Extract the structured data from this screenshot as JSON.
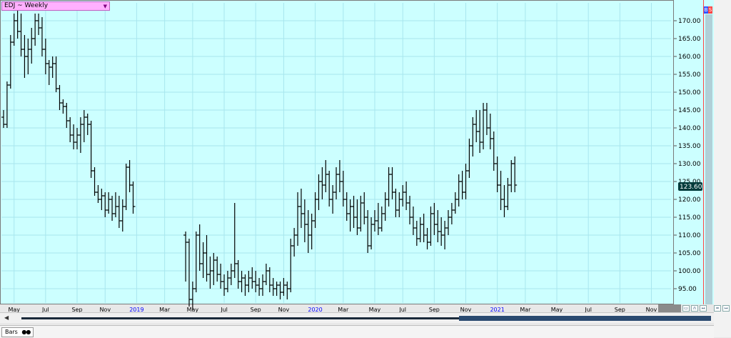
{
  "window": {
    "title": "EDJ ~ Weekly"
  },
  "footer": {
    "tab_label": "Bars"
  },
  "badge": {
    "b": "B",
    "s": "S"
  },
  "scroll": {
    "left_arrow": "◀"
  },
  "colors": {
    "plot_bg": "#ccffff",
    "bars": "#000000",
    "grid": "#a8e6ee",
    "price_tag_bg": "#003a3a",
    "price_tag_fg": "#ffffff",
    "year_label": "#0000ff"
  },
  "chart_data": {
    "type": "ohlc",
    "title": "EDJ ~ Weekly",
    "xlabel": "",
    "ylabel": "",
    "last_price": 123.6,
    "last_price_label": "123.60",
    "ylim": [
      91.0,
      175.0
    ],
    "y_ticks": [
      95,
      100,
      105,
      110,
      115,
      120,
      125,
      130,
      135,
      140,
      145,
      150,
      155,
      160,
      165,
      170
    ],
    "y_tick_labels": [
      "95.00",
      "100.00",
      "105.00",
      "110.00",
      "115.00",
      "120.00",
      "125.00",
      "130.00",
      "135.00",
      "140.00",
      "145.00",
      "150.00",
      "155.00",
      "160.00",
      "165.00",
      "170.00"
    ],
    "x_tick_labels": [
      {
        "label": "May",
        "week": 3,
        "year": false
      },
      {
        "label": "Jul",
        "week": 12,
        "year": false
      },
      {
        "label": "Sep",
        "week": 21,
        "year": false
      },
      {
        "label": "Nov",
        "week": 29,
        "year": false
      },
      {
        "label": "2019",
        "week": 38,
        "year": true
      },
      {
        "label": "Mar",
        "week": 46,
        "year": false
      },
      {
        "label": "May",
        "week": 54,
        "year": false
      },
      {
        "label": "Jul",
        "week": 63,
        "year": false
      },
      {
        "label": "Sep",
        "week": 72,
        "year": false
      },
      {
        "label": "Nov",
        "week": 80,
        "year": false
      },
      {
        "label": "2020",
        "week": 89,
        "year": true
      },
      {
        "label": "Mar",
        "week": 97,
        "year": false
      },
      {
        "label": "May",
        "week": 106,
        "year": false
      },
      {
        "label": "Jul",
        "week": 114,
        "year": false
      },
      {
        "label": "Sep",
        "week": 123,
        "year": false
      },
      {
        "label": "Nov",
        "week": 132,
        "year": false
      },
      {
        "label": "2021",
        "week": 141,
        "year": true
      },
      {
        "label": "Mar",
        "week": 149,
        "year": false
      },
      {
        "label": "May",
        "week": 158,
        "year": false
      },
      {
        "label": "Jul",
        "week": 167,
        "year": false
      },
      {
        "label": "Sep",
        "week": 176,
        "year": false
      },
      {
        "label": "Nov",
        "week": 185,
        "year": false
      }
    ],
    "bars": [
      [
        143,
        145,
        140,
        141
      ],
      [
        141,
        153,
        140,
        152
      ],
      [
        152,
        166,
        151,
        164
      ],
      [
        164,
        172,
        163,
        170
      ],
      [
        170,
        173,
        165,
        167
      ],
      [
        167,
        172,
        160,
        162
      ],
      [
        162,
        166,
        154,
        160
      ],
      [
        160,
        165,
        155,
        162
      ],
      [
        162,
        168,
        158,
        165
      ],
      [
        165,
        172,
        163,
        170
      ],
      [
        170,
        172,
        166,
        168
      ],
      [
        168,
        171,
        160,
        162
      ],
      [
        162,
        165,
        155,
        158
      ],
      [
        158,
        159,
        152,
        157
      ],
      [
        157,
        160,
        154,
        158
      ],
      [
        158,
        160,
        150,
        151
      ],
      [
        151,
        152,
        145,
        147
      ],
      [
        147,
        148,
        144,
        146
      ],
      [
        146,
        147,
        140,
        142
      ],
      [
        142,
        143,
        136,
        138
      ],
      [
        138,
        141,
        134,
        136
      ],
      [
        136,
        140,
        134,
        138
      ],
      [
        138,
        143,
        133,
        141
      ],
      [
        141,
        145,
        136,
        143
      ],
      [
        143,
        144,
        138,
        141
      ],
      [
        141,
        142,
        126,
        128
      ],
      [
        128,
        129,
        121,
        122
      ],
      [
        122,
        124,
        119,
        120
      ],
      [
        120,
        123,
        117,
        121
      ],
      [
        121,
        122,
        115,
        117
      ],
      [
        117,
        122,
        116,
        120
      ],
      [
        120,
        121,
        114,
        116
      ],
      [
        116,
        122,
        115,
        118
      ],
      [
        118,
        121,
        112,
        114
      ],
      [
        114,
        120,
        111,
        118
      ],
      [
        118,
        130,
        117,
        129
      ],
      [
        129,
        131,
        122,
        124
      ],
      [
        124,
        125,
        116,
        118
      ],
      [
        110,
        111,
        97,
        108
      ],
      [
        108,
        109,
        90,
        92
      ],
      [
        92,
        97,
        89,
        95
      ],
      [
        95,
        111,
        94,
        110
      ],
      [
        110,
        113,
        100,
        102
      ],
      [
        102,
        108,
        98,
        105
      ],
      [
        105,
        110,
        97,
        99
      ],
      [
        99,
        104,
        95,
        100
      ],
      [
        100,
        105,
        96,
        103
      ],
      [
        103,
        104,
        97,
        99
      ],
      [
        99,
        102,
        95,
        97
      ],
      [
        97,
        99,
        93,
        95
      ],
      [
        95,
        100,
        94,
        98
      ],
      [
        98,
        102,
        96,
        100
      ],
      [
        100,
        119,
        98,
        102
      ],
      [
        102,
        103,
        95,
        97
      ],
      [
        97,
        100,
        94,
        98
      ],
      [
        98,
        99,
        93,
        96
      ],
      [
        96,
        100,
        94,
        98
      ],
      [
        98,
        101,
        95,
        97
      ],
      [
        97,
        100,
        94,
        96
      ],
      [
        96,
        98,
        93,
        95
      ],
      [
        95,
        99,
        93,
        97
      ],
      [
        97,
        102,
        96,
        100
      ],
      [
        100,
        101,
        94,
        96
      ],
      [
        96,
        98,
        93,
        95
      ],
      [
        95,
        97,
        93,
        96
      ],
      [
        96,
        97,
        92,
        94
      ],
      [
        94,
        98,
        93,
        96
      ],
      [
        96,
        97,
        92,
        95
      ],
      [
        95,
        109,
        94,
        107
      ],
      [
        107,
        112,
        104,
        110
      ],
      [
        110,
        122,
        107,
        118
      ],
      [
        118,
        123,
        112,
        116
      ],
      [
        116,
        120,
        108,
        113
      ],
      [
        113,
        117,
        105,
        110
      ],
      [
        110,
        116,
        106,
        114
      ],
      [
        114,
        122,
        112,
        120
      ],
      [
        120,
        127,
        117,
        125
      ],
      [
        125,
        129,
        120,
        124
      ],
      [
        124,
        131,
        122,
        127
      ],
      [
        127,
        128,
        118,
        120
      ],
      [
        120,
        124,
        116,
        122
      ],
      [
        122,
        129,
        120,
        127
      ],
      [
        127,
        131,
        122,
        125
      ],
      [
        125,
        128,
        118,
        120
      ],
      [
        120,
        122,
        114,
        116
      ],
      [
        116,
        120,
        111,
        118
      ],
      [
        118,
        121,
        112,
        115
      ],
      [
        115,
        120,
        110,
        112
      ],
      [
        112,
        121,
        111,
        119
      ],
      [
        119,
        122,
        113,
        115
      ],
      [
        115,
        117,
        105,
        107
      ],
      [
        107,
        115,
        106,
        113
      ],
      [
        113,
        117,
        111,
        114
      ],
      [
        114,
        119,
        110,
        112
      ],
      [
        112,
        118,
        111,
        116
      ],
      [
        116,
        122,
        114,
        120
      ],
      [
        120,
        129,
        118,
        127
      ],
      [
        127,
        129,
        120,
        122
      ],
      [
        122,
        123,
        115,
        117
      ],
      [
        117,
        122,
        115,
        120
      ],
      [
        120,
        124,
        118,
        122
      ],
      [
        122,
        125,
        117,
        119
      ],
      [
        119,
        121,
        113,
        115
      ],
      [
        115,
        118,
        110,
        112
      ],
      [
        112,
        114,
        107,
        109
      ],
      [
        109,
        115,
        108,
        113
      ],
      [
        113,
        116,
        108,
        110
      ],
      [
        110,
        112,
        106,
        108
      ],
      [
        108,
        118,
        107,
        116
      ],
      [
        116,
        119,
        110,
        113
      ],
      [
        113,
        117,
        108,
        111
      ],
      [
        111,
        115,
        107,
        110
      ],
      [
        110,
        114,
        106,
        112
      ],
      [
        112,
        117,
        110,
        115
      ],
      [
        115,
        119,
        113,
        117
      ],
      [
        117,
        122,
        116,
        120
      ],
      [
        120,
        127,
        118,
        125
      ],
      [
        125,
        128,
        120,
        122
      ],
      [
        122,
        130,
        120,
        128
      ],
      [
        128,
        137,
        126,
        135
      ],
      [
        135,
        143,
        132,
        141
      ],
      [
        141,
        145,
        136,
        139
      ],
      [
        139,
        145,
        133,
        136
      ],
      [
        136,
        147,
        134,
        145
      ],
      [
        145,
        147,
        138,
        140
      ],
      [
        140,
        144,
        134,
        137
      ],
      [
        137,
        139,
        128,
        130
      ],
      [
        130,
        132,
        122,
        124
      ],
      [
        124,
        128,
        117,
        120
      ],
      [
        120,
        124,
        115,
        118
      ],
      [
        118,
        126,
        117,
        124
      ],
      [
        124,
        131,
        122,
        130
      ],
      [
        130,
        132,
        122,
        124
      ]
    ]
  }
}
